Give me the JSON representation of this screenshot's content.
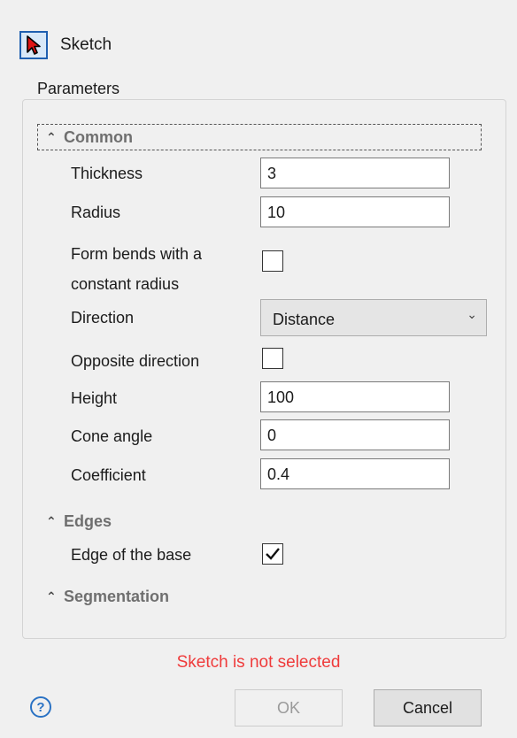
{
  "header": {
    "sketch_label": "Sketch",
    "sketch_icon": "cursor-arrow-icon"
  },
  "parameters": {
    "title": "Parameters",
    "common": {
      "title": "Common",
      "thickness_label": "Thickness",
      "thickness_value": "3",
      "radius_label": "Radius",
      "radius_value": "10",
      "form_bends_label_line1": "Form bends with a",
      "form_bends_label_line2": "constant radius",
      "form_bends_checked": false,
      "direction_label": "Direction",
      "direction_value": "Distance",
      "opposite_label": "Opposite direction",
      "opposite_checked": false,
      "height_label": "Height",
      "height_value": "100",
      "cone_label": "Cone angle",
      "cone_value": "0",
      "coefficient_label": "Coefficient",
      "coefficient_value": "0.4"
    },
    "edges": {
      "title": "Edges",
      "edge_base_label": "Edge of the base",
      "edge_base_checked": true
    },
    "segmentation": {
      "title": "Segmentation"
    }
  },
  "status": {
    "message": "Sketch is not selected",
    "color": "#ef3b3b"
  },
  "footer": {
    "ok_label": "OK",
    "cancel_label": "Cancel",
    "help_glyph": "?"
  },
  "colors": {
    "accent": "#1f5fb0",
    "section_header": "#6f6f6f"
  }
}
